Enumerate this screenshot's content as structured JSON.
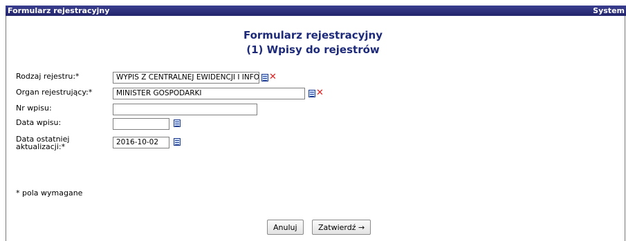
{
  "titlebar": {
    "title": "Formularz rejestracyjny",
    "right": "System"
  },
  "heading": {
    "line1": "Formularz rejestracyjny",
    "line2": "(1) Wpisy do rejestrów"
  },
  "fields": {
    "rodzaj_rejestru": {
      "label": "Rodzaj rejestru:*",
      "value": "WYPIS Z CENTRALNEJ EWIDENCJI I INFORMACJI"
    },
    "organ_rejestrujacy": {
      "label": "Organ rejestrujący:*",
      "value": "MINISTER GOSPODARKI"
    },
    "nr_wpisu": {
      "label": "Nr wpisu:",
      "value": ""
    },
    "data_wpisu": {
      "label": "Data wpisu:",
      "value": ""
    },
    "data_aktualizacji": {
      "label_line1": "Data ostatniej",
      "label_line2": "aktualizacji:*",
      "value": "2016-10-02"
    }
  },
  "note": "* pola wymagane",
  "buttons": {
    "cancel": "Anuluj",
    "confirm": "Zatwierdź →"
  },
  "icons": {
    "list": "list-icon",
    "clear": "clear-icon"
  },
  "colors": {
    "titlebar": "#2a2d78",
    "heading": "#1d2a7a",
    "clear": "#e11d1d"
  }
}
